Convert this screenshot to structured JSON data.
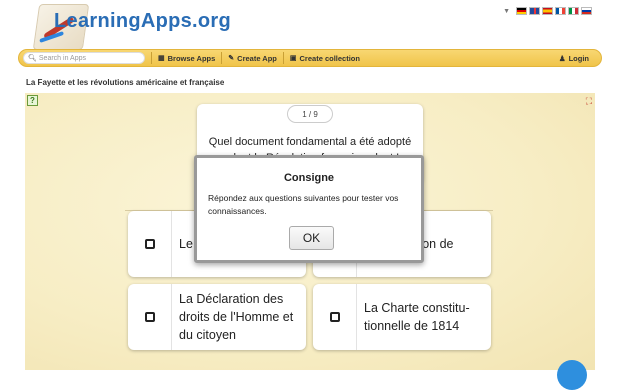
{
  "header": {
    "logo_text": "LearningApps.org",
    "flags": [
      "de",
      "gb",
      "es",
      "fr",
      "it",
      "ru"
    ]
  },
  "navbar": {
    "search_placeholder": "Search in Apps",
    "browse_label": "Browse Apps",
    "create_label": "Create App",
    "collection_label": "Create collection",
    "login_label": "Login"
  },
  "page": {
    "title": "La Fayette et les révolutions américaine et française"
  },
  "quiz": {
    "counter": "1 / 9",
    "question_line1": "Quel document fondamental a été adopté",
    "question_line2": "pendant la Révolution française, dont La",
    "answers": [
      {
        "text": "Le"
      },
      {
        "text": "ution de"
      },
      {
        "line1": "La Déclaration des",
        "line2": "droits de l'Homme et",
        "line3": "du citoyen"
      },
      {
        "line1": "La Charte constitu-",
        "line2": "tionnelle de 1814"
      }
    ]
  },
  "modal": {
    "title": "Consigne",
    "text": "Répondez aux questions suivantes pour tester vos connaissances.",
    "ok_label": "OK"
  },
  "colors": {
    "navbar": "#f0c44a",
    "logo": "#2a6db5",
    "stage": "#f7edc4",
    "fab": "#2e8fde"
  }
}
